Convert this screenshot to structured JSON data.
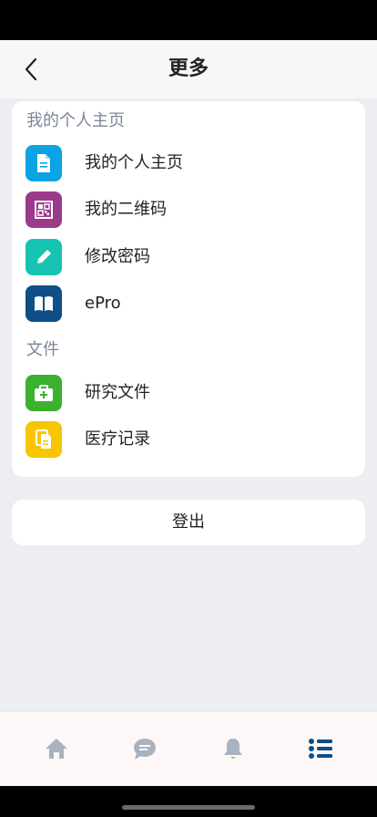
{
  "nav": {
    "title": "更多",
    "back_icon": "chevron-left-icon"
  },
  "sections": {
    "profile": {
      "header": "我的个人主页",
      "items": [
        {
          "label": "我的个人主页",
          "icon": "document-icon",
          "color": "#0aa3e3"
        },
        {
          "label": "我的二维码",
          "icon": "qr-code-icon",
          "color": "#9b3a8a"
        },
        {
          "label": "修改密码",
          "icon": "pencil-icon",
          "color": "#17c3b2"
        },
        {
          "label": "ePro",
          "icon": "book-icon",
          "color": "#0d4f86"
        }
      ]
    },
    "files": {
      "header": "文件",
      "items": [
        {
          "label": "研究文件",
          "icon": "medical-kit-icon",
          "color": "#3cb02f"
        },
        {
          "label": "医疗记录",
          "icon": "documents-icon",
          "color": "#f7c600"
        }
      ]
    }
  },
  "logout": {
    "label": "登出"
  },
  "tabbar": {
    "tabs": [
      {
        "icon": "home-icon",
        "active": false
      },
      {
        "icon": "chat-icon",
        "active": false
      },
      {
        "icon": "bell-icon",
        "active": false
      },
      {
        "icon": "list-icon",
        "active": true
      }
    ],
    "active_color": "#0d4f86",
    "inactive_color": "#a9b2bf"
  }
}
